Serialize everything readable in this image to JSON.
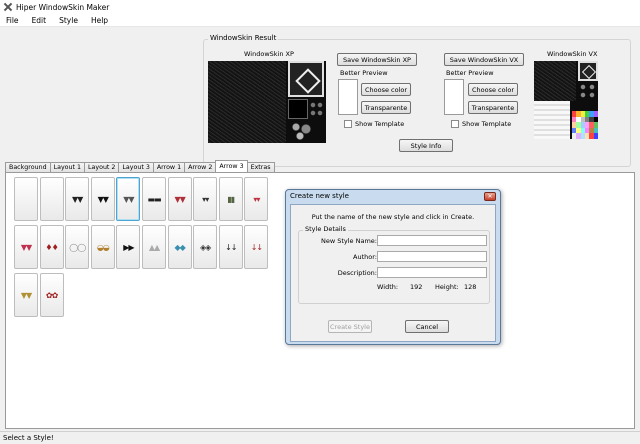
{
  "window": {
    "title": "Hiper WindowSkin Maker"
  },
  "menu": [
    "File",
    "Edit",
    "Style",
    "Help"
  ],
  "result": {
    "group_title": "WindowSkin Result",
    "xp": {
      "label": "WindowSkin XP",
      "save_label": "Save WindowSkin XP",
      "better_preview": "Better Preview",
      "choose_color": "Choose color",
      "transparent": "Transparente",
      "show_template": "Show Template"
    },
    "vx": {
      "label": "WindowSkin VX",
      "save_label": "Save WindowSkin VX",
      "better_preview": "Better Preview",
      "choose_color": "Choose color",
      "transparent": "Transparente",
      "show_template": "Show Template"
    },
    "style_info": "Style Info"
  },
  "tabs": [
    "Background",
    "Layout 1",
    "Layout 2",
    "Layout 3",
    "Arrow 1",
    "Arrow 2",
    "Arrow 3",
    "Extras"
  ],
  "active_tab": "Arrow 3",
  "tiles": [
    {
      "glyph": "",
      "color": "#999999"
    },
    {
      "glyph": "",
      "color": "#999999"
    },
    {
      "glyph": "▼▼",
      "color": "#222222"
    },
    {
      "glyph": "▼▼",
      "color": "#111111"
    },
    {
      "glyph": "▼▼",
      "color": "#555555"
    },
    {
      "glyph": "▬▬",
      "color": "#222222"
    },
    {
      "glyph": "▼▼",
      "color": "#b0303a"
    },
    {
      "glyph": "▾▾",
      "color": "#333333"
    },
    {
      "glyph": "▮▮",
      "color": "#556644"
    },
    {
      "glyph": "▾▾",
      "color": "#c03040"
    },
    {
      "glyph": "▼▼",
      "color": "#c03050"
    },
    {
      "glyph": "♦♦",
      "color": "#a02020"
    },
    {
      "glyph": "◯◯",
      "color": "#888888"
    },
    {
      "glyph": "◒◒",
      "color": "#b08030"
    },
    {
      "glyph": "▶▶",
      "color": "#111111"
    },
    {
      "glyph": "▲▲",
      "color": "#aaaaaa"
    },
    {
      "glyph": "◆◆",
      "color": "#3a8fb0"
    },
    {
      "glyph": "◈◈",
      "color": "#333333"
    },
    {
      "glyph": "↓↓",
      "color": "#222222"
    },
    {
      "glyph": "↓↓",
      "color": "#a02828"
    },
    {
      "glyph": "▼▼",
      "color": "#b09030"
    },
    {
      "glyph": "✿✿",
      "color": "#a02020"
    }
  ],
  "selected_tile": 4,
  "dialog": {
    "title": "Create new style",
    "instruction": "Put the name of the new style and click in Create.",
    "details_title": "Style Details",
    "name_label": "New Style Name:",
    "author_label": "Author:",
    "description_label": "Description:",
    "name_value": "",
    "author_value": "",
    "description_value": "",
    "width_label": "Width:",
    "width_value": "192",
    "height_label": "Height:",
    "height_value": "128",
    "create_label": "Create Style",
    "cancel_label": "Cancel"
  },
  "status": "Select a Style!",
  "palette_colors": [
    "#ff4040",
    "#ffb030",
    "#f0f040",
    "#40d040",
    "#40a0ff",
    "#a060ff",
    "#ff80c0",
    "#ffffff",
    "#c0c0c0",
    "#808080",
    "#404040",
    "#000000",
    "#ffd0a0",
    "#a0ffa0",
    "#a0d0ff",
    "#ffa0ff",
    "#ff6060",
    "#60c060",
    "#6080ff",
    "#ffff80",
    "#80ffff",
    "#ff80ff",
    "#c08040",
    "#40c0c0",
    "#f0f0f0",
    "#e0b0ff",
    "#b0e0ff",
    "#ffe0b0",
    "#ff4040",
    "#4040ff"
  ]
}
